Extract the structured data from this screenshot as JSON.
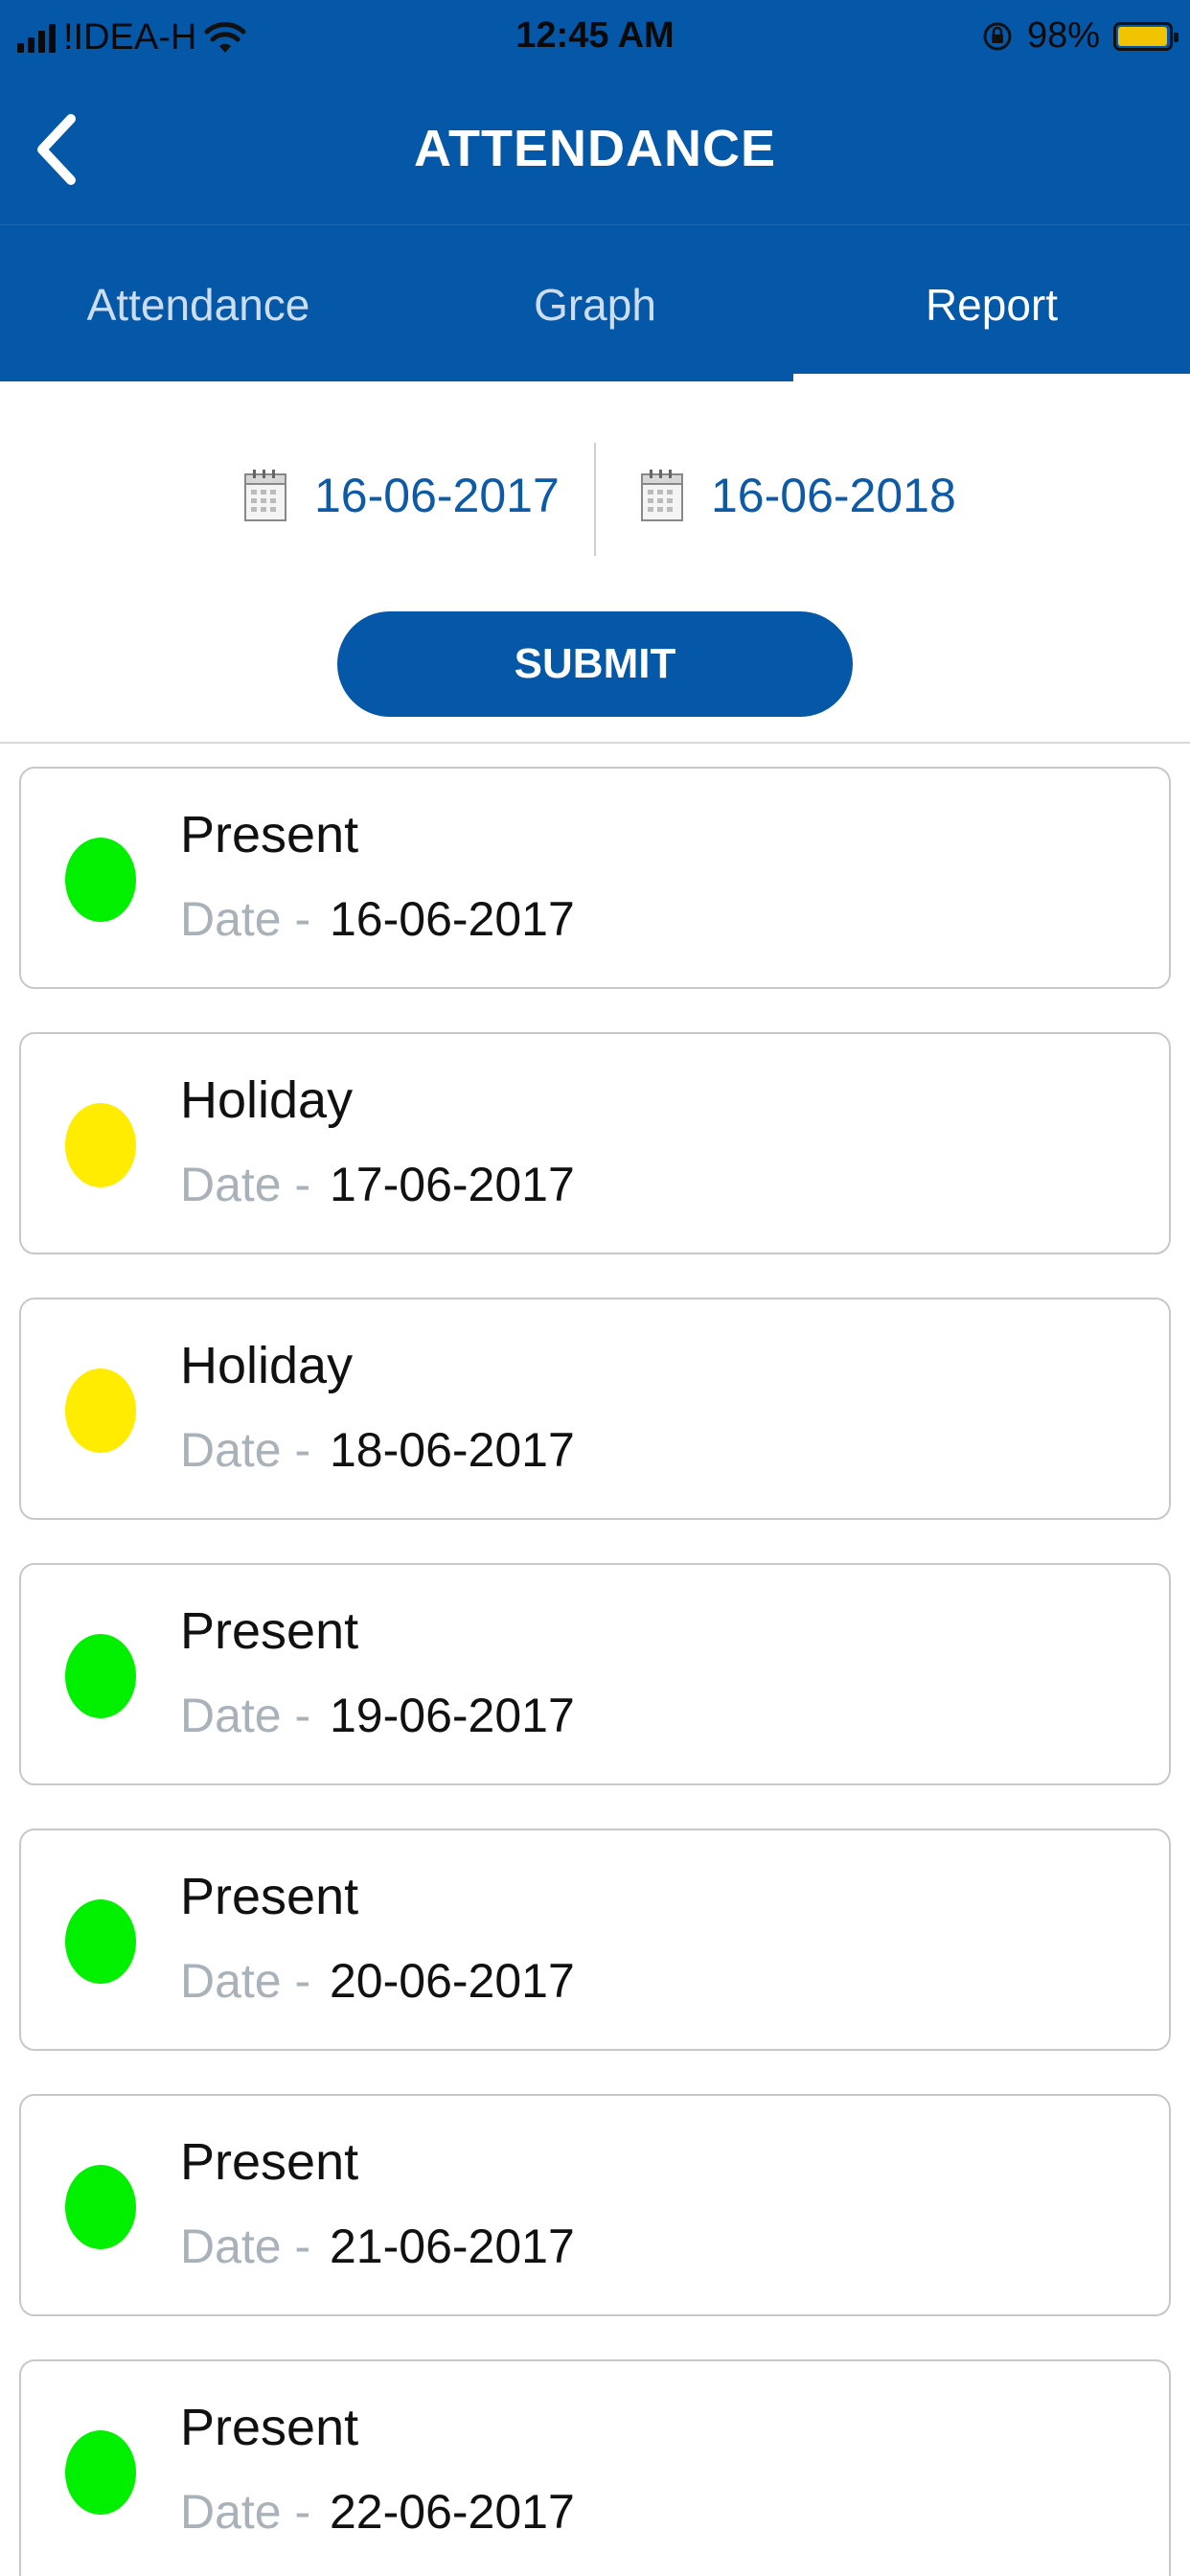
{
  "status_bar": {
    "carrier": "!IDEA-H",
    "time": "12:45 AM",
    "battery_percent": "98%",
    "battery_level": 0.98,
    "icons": [
      "signal-icon",
      "wifi-icon",
      "rotation-lock-icon",
      "battery-icon"
    ]
  },
  "header": {
    "title": "ATTENDANCE",
    "back_icon": "chevron-left-icon"
  },
  "tabs": [
    {
      "label": "Attendance",
      "active": false
    },
    {
      "label": "Graph",
      "active": false
    },
    {
      "label": "Report",
      "active": true
    }
  ],
  "date_range": {
    "from": "16-06-2017",
    "to": "16-06-2018",
    "icon": "calendar-icon"
  },
  "submit_label": "SUBMIT",
  "colors": {
    "primary": "#0557a8",
    "present": "#00f000",
    "holiday": "#ffec00",
    "date_label": "#a9b1b9"
  },
  "records": [
    {
      "status": "Present",
      "date_label": "Date -",
      "date": "16-06-2017",
      "color": "#00f000"
    },
    {
      "status": "Holiday",
      "date_label": "Date -",
      "date": "17-06-2017",
      "color": "#ffec00"
    },
    {
      "status": "Holiday",
      "date_label": "Date -",
      "date": "18-06-2017",
      "color": "#ffec00"
    },
    {
      "status": "Present",
      "date_label": "Date -",
      "date": "19-06-2017",
      "color": "#00f000"
    },
    {
      "status": "Present",
      "date_label": "Date -",
      "date": "20-06-2017",
      "color": "#00f000"
    },
    {
      "status": "Present",
      "date_label": "Date -",
      "date": "21-06-2017",
      "color": "#00f000"
    },
    {
      "status": "Present",
      "date_label": "Date -",
      "date": "22-06-2017",
      "color": "#00f000"
    }
  ]
}
